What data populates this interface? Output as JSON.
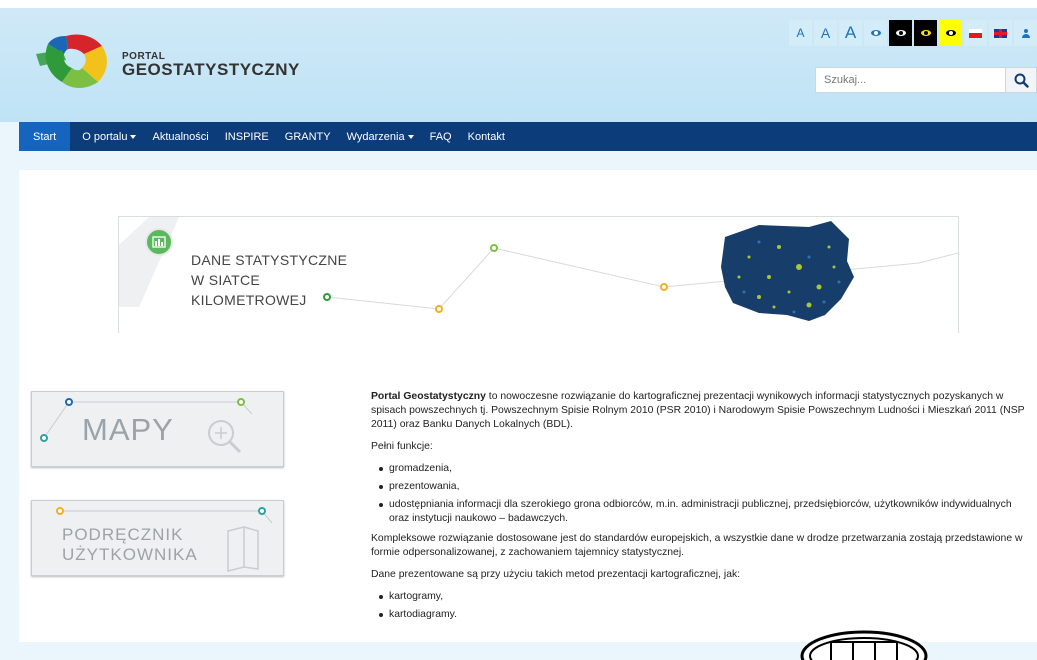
{
  "logo": {
    "line1": "PORTAL",
    "line2": "GEOSTATYSTYCZNY"
  },
  "toolbar": {
    "font_small": "A",
    "font_medium": "A",
    "font_large": "A",
    "contrast_buttons": [
      "eye-default",
      "eye-dark",
      "eye-dark-yellow",
      "eye-yellow"
    ],
    "languages": [
      "pl-flag",
      "uk-flag"
    ],
    "user_icon": "user-icon"
  },
  "search": {
    "placeholder": "Szukaj...",
    "button_icon": "search-icon"
  },
  "nav": {
    "items": [
      {
        "label": "Start",
        "active": true,
        "dropdown": false
      },
      {
        "label": "O portalu",
        "dropdown": true
      },
      {
        "label": "Aktualności",
        "dropdown": false
      },
      {
        "label": "INSPIRE",
        "dropdown": false
      },
      {
        "label": "GRANTY",
        "dropdown": false
      },
      {
        "label": "Wydarzenia",
        "dropdown": true
      },
      {
        "label": "FAQ",
        "dropdown": false
      },
      {
        "label": "Kontakt",
        "dropdown": false
      }
    ]
  },
  "banner": {
    "line1": "DANE STATYSTYCZNE",
    "line2": "W SIATCE",
    "line3": "KILOMETROWEJ"
  },
  "sidebar": {
    "mapy_label": "MAPY",
    "podrecznik_line1": "PODRĘCZNIK",
    "podrecznik_line2": "UŻYTKOWNIKA"
  },
  "article": {
    "intro_bold": "Portal Geostatystyczny",
    "intro_rest": " to nowoczesne rozwiązanie do kartograficznej prezentacji wynikowych informacji statystycznych pozyskanych w spisach powszechnych tj. Powszechnym Spisie Rolnym 2010 (PSR 2010) i Narodowym Spisie Powszechnym Ludności i Mieszkań 2011 (NSP 2011) oraz Banku Danych Lokalnych (BDL).",
    "functions_heading": "Pełni funkcje:",
    "functions": [
      "gromadzenia,",
      "prezentowania,",
      "udostępniania informacji dla szerokiego grona odbiorców, m.in. administracji publicznej, przedsiębiorców, użytkowników indywidualnych oraz instytucji naukowo – badawczych."
    ],
    "para2": "Kompleksowe rozwiązanie dostosowane jest do standardów europejskich, a wszystkie dane w drodze przetwarzania zostają przedstawione w formie odpersonalizowanej, z zachowaniem tajemnicy statystycznej.",
    "methods_heading": "Dane prezentowane są przy użyciu takich metod prezentacji kartograficznej, jak:",
    "methods": [
      "kartogramy,",
      "kartodiagramy."
    ]
  },
  "colors": {
    "nav_bg": "#0d3c7a",
    "nav_active": "#1565c0",
    "header_bg": "#c5e6f7",
    "accent_green": "#5cb85c"
  }
}
